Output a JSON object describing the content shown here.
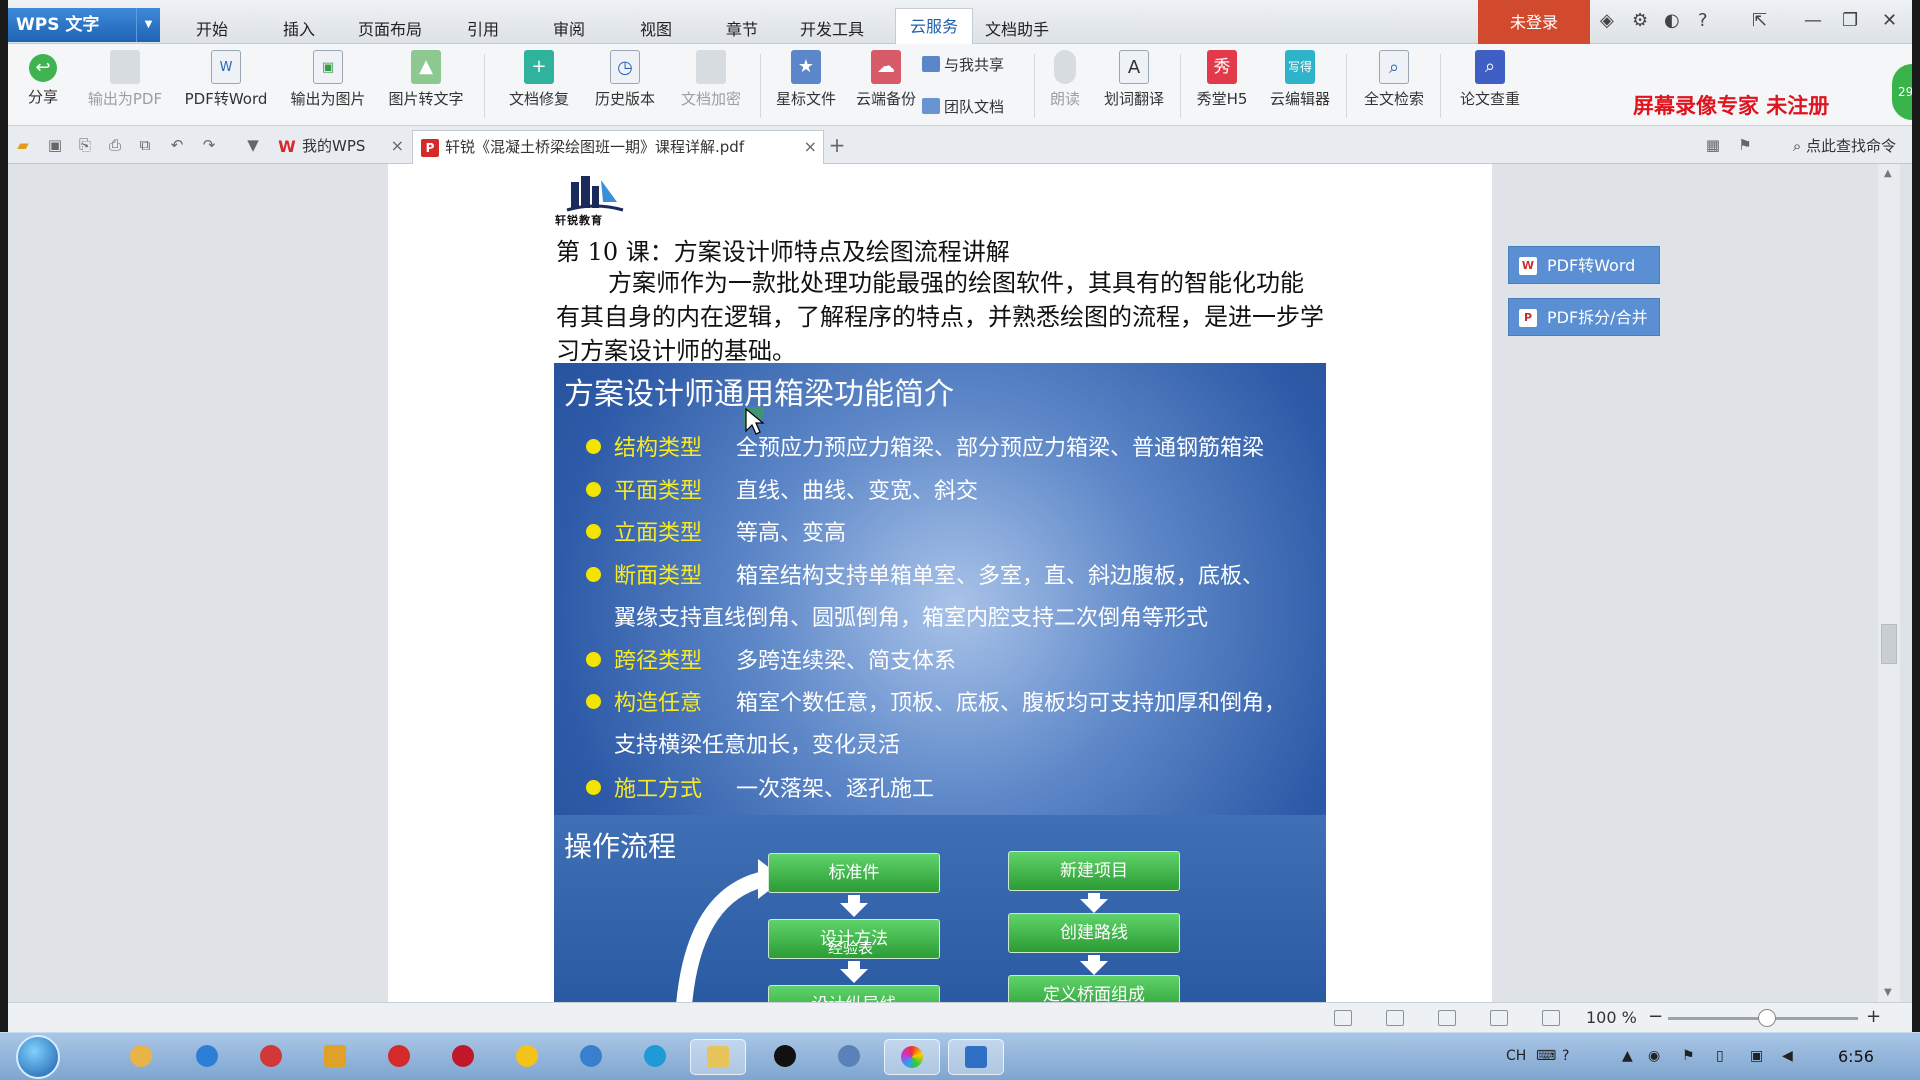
{
  "app": {
    "title": "WPS 文字"
  },
  "menu": {
    "items": [
      "开始",
      "插入",
      "页面布局",
      "引用",
      "审阅",
      "视图",
      "章节",
      "开发工具",
      "云服务",
      "文档助手"
    ],
    "active_index": 8,
    "login_label": "未登录"
  },
  "ribbon": {
    "share": "分享",
    "export_pdf": "输出为PDF",
    "pdf_to_word": "PDF转Word",
    "export_image": "输出为图片",
    "image_to_text": "图片转文字",
    "doc_repair": "文档修复",
    "history": "历史版本",
    "doc_encrypt": "文档加密",
    "starred": "星标文件",
    "cloud_backup": "云端备份",
    "shared_with_me": "与我共享",
    "team_docs": "团队文档",
    "read_aloud": "朗读",
    "word_translate": "划词翻译",
    "show_h5": "秀堂H5",
    "cloud_editor": "云编辑器",
    "fulltext_search": "全文检索",
    "paper_check": "论文查重",
    "h5_icon_text": "秀",
    "editor_icon_text": "写得"
  },
  "watermark": "屏幕录像专家  未注册",
  "bubble_number": "29",
  "tabs": {
    "my_wps": "我的WPS",
    "current_doc": "轩锐《混凝土桥梁绘图班一期》课程详解.pdf",
    "search_cmd": "点此查找命令"
  },
  "document": {
    "logo_text": "轩锐教育",
    "lesson_title": "第 10 课：方案设计师特点及绘图流程讲解",
    "intro": "方案师作为一款批处理功能最强的绘图软件，其具有的智能化功能有其自身的内在逻辑，了解程序的特点，并熟悉绘图的流程，是进一步学习方案设计师的基础。",
    "slide": {
      "title": "方案设计师通用箱梁功能简介",
      "bullets": [
        {
          "label": "结构类型",
          "text": "全预应力预应力箱梁、部分预应力箱梁、普通钢筋箱梁"
        },
        {
          "label": "平面类型",
          "text": "直线、曲线、变宽、斜交"
        },
        {
          "label": "立面类型",
          "text": "等高、变高"
        },
        {
          "label": "断面类型",
          "text": "箱室结构支持单箱单室、多室，直、斜边腹板，底板、",
          "cont": "翼缘支持直线倒角、圆弧倒角，箱室内腔支持二次倒角等形式"
        },
        {
          "label": "跨径类型",
          "text": "多跨连续梁、简支体系"
        },
        {
          "label": "构造任意",
          "text": "箱室个数任意，顶板、底板、腹板均可支持加厚和倒角，",
          "cont": "支持横梁任意加长，变化灵活"
        },
        {
          "label": "施工方式",
          "text": "一次落架、逐孔施工"
        }
      ],
      "flow_title": "操作流程",
      "flow_left": [
        "标准件",
        "设计方法",
        "设计纵导线"
      ],
      "flow_right": [
        "新建项目",
        "创建路线",
        "定义桥面组成"
      ],
      "exp_label": "经验表"
    }
  },
  "right_panel": {
    "pdf_to_word": "PDF转Word",
    "pdf_split_merge": "PDF拆分/合并"
  },
  "status": {
    "zoom": "100 %",
    "zoom_level_percent": 100
  },
  "taskbar": {
    "clock": "6:56",
    "lang": "CH"
  }
}
